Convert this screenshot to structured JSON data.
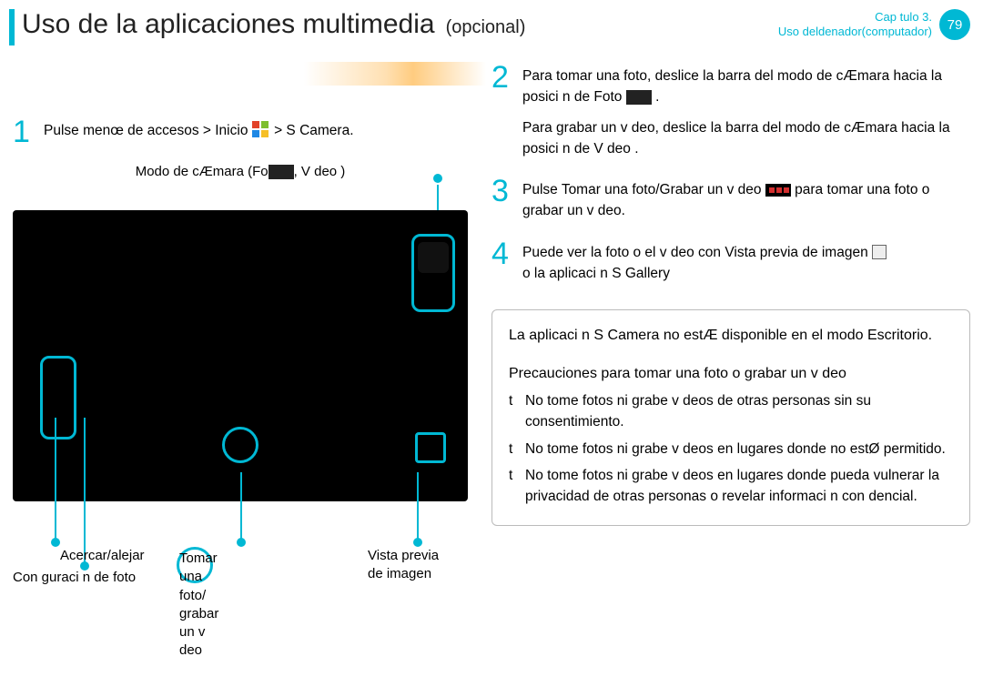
{
  "header": {
    "title": "Uso de la aplicaciones multimedia",
    "subtitle": "(opcional)",
    "chapter_line1": "Cap tulo 3.",
    "chapter_line2": "Uso deldenador(computador)",
    "page_number": "79"
  },
  "left": {
    "step1_a": "Pulse",
    "step1_b": "menœ de accesos > Inicio",
    "step1_c": " > S Camera.",
    "mode_caption_a": "Modo de cÆmara (Fo",
    "mode_caption_b": ", V deo        )",
    "labels": {
      "zoom": "Acercar/alejar",
      "photo_config": "Con guraci n de foto",
      "shutter_l1": "Tomar una foto/",
      "shutter_l2": "grabar un v deo",
      "preview_l1": "Vista previa",
      "preview_l2": "de imagen"
    }
  },
  "right": {
    "step2_a": "Para tomar una foto, deslice la barra del modo de cÆmara hacia la posici n de Foto",
    "step2_b": ".",
    "step2_c": "Para grabar un v deo, deslice la barra del modo de cÆmara hacia la posici n de V deo       .",
    "step3_a": "Pulse",
    "step3_b": "Tomar una foto/Grabar un v deo",
    "step3_c": " para tomar una foto o grabar un v deo.",
    "step4_a": "Puede ver la foto o el v deo con Vista previa de imagen",
    "step4_b": "o la aplicaci n S Gallery",
    "info1": "La aplicaci n S Camera no estÆ disponible en el modo Escritorio.",
    "info2_title": "Precauciones para tomar una foto o grabar un v deo",
    "info2_items": [
      "No tome fotos ni grabe v deos de otras personas sin su consentimiento.",
      "No tome fotos ni grabe v deos en lugares donde no estØ permitido.",
      "No tome fotos ni grabe v deos en lugares donde pueda vulnerar la privacidad de otras personas o revelar informaci n con dencial."
    ]
  },
  "bullet": "t"
}
